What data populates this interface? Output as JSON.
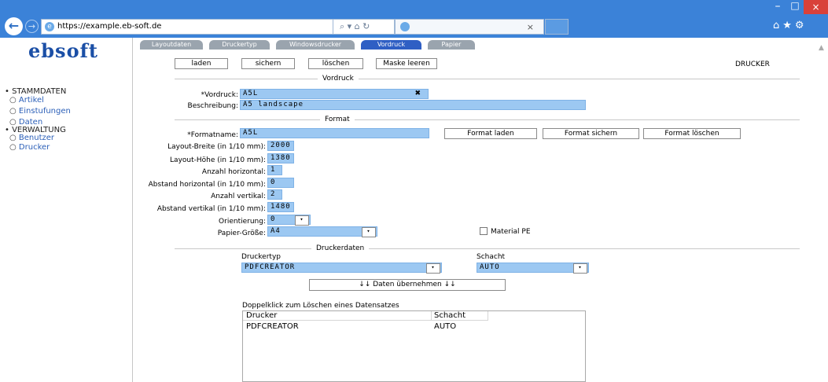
{
  "browser": {
    "url": "https://example.eb-soft.de",
    "addr_icons": "⌕ ▾ ⌂ ↻",
    "tab_close": "×",
    "back": "←",
    "forward": "→",
    "toolbar_icons": "⌂★⚙",
    "win_min": "–",
    "win_max": "□",
    "win_close": "×"
  },
  "sidebar": {
    "logo": "ebsoft",
    "sections": [
      {
        "label": "STAMMDATEN",
        "items": [
          "Artikel",
          "Einstufungen",
          "Daten"
        ]
      },
      {
        "label": "VERWALTUNG",
        "items": [
          "Benutzer",
          "Drucker"
        ]
      }
    ]
  },
  "tabs": [
    "Layoutdaten",
    "Druckertyp",
    "Windowsdrucker",
    "Vordruck",
    "Papier"
  ],
  "active_tab": "Vordruck",
  "toolbar": {
    "laden": "laden",
    "sichern": "sichern",
    "loeschen": "löschen",
    "maske_leeren": "Maske leeren",
    "page_label": "DRUCKER"
  },
  "vordruck_section": {
    "title": "Vordruck",
    "vordruck_label": "*Vordruck:",
    "vordruck_value": "A5L",
    "clear_icon": "✖",
    "beschreibung_label": "Beschreibung:",
    "beschreibung_value": "A5 landscape"
  },
  "format_section": {
    "title": "Format",
    "formatname_label": "*Formatname:",
    "formatname_value": "A5L",
    "format_laden": "Format laden",
    "format_sichern": "Format sichern",
    "format_loeschen": "Format löschen",
    "layout_breite_label": "Layout-Breite (in 1/10 mm):",
    "layout_breite_value": "2000",
    "layout_hoehe_label": "Layout-Höhe (in 1/10 mm):",
    "layout_hoehe_value": "1380",
    "anzahl_horizontal_label": "Anzahl horizontal:",
    "anzahl_horizontal_value": "1",
    "abstand_horizontal_label": "Abstand horizontal (in 1/10 mm):",
    "abstand_horizontal_value": "0",
    "anzahl_vertikal_label": "Anzahl vertikal:",
    "anzahl_vertikal_value": "2",
    "abstand_vertikal_label": "Abstand vertikal (in 1/10 mm):",
    "abstand_vertikal_value": "1480",
    "orientierung_label": "Orientierung:",
    "orientierung_value": "0",
    "papier_groesse_label": "Papier-Größe:",
    "papier_groesse_value": "A4",
    "material_pe_label": "Material PE"
  },
  "druckerdaten_section": {
    "title": "Druckerdaten",
    "druckertyp_label": "Druckertyp",
    "druckertyp_value": "PDFCREATOR",
    "schacht_label": "Schacht",
    "schacht_value": "AUTO",
    "uebernehmen_button": "↓↓ Daten übernehmen ↓↓",
    "hint": "Doppelklick zum Löschen eines Datensatzes",
    "list_headers": [
      "Drucker",
      "Schacht"
    ],
    "list_rows": [
      [
        "PDFCREATOR",
        "AUTO"
      ]
    ]
  },
  "dropdown_arrow": "▾"
}
